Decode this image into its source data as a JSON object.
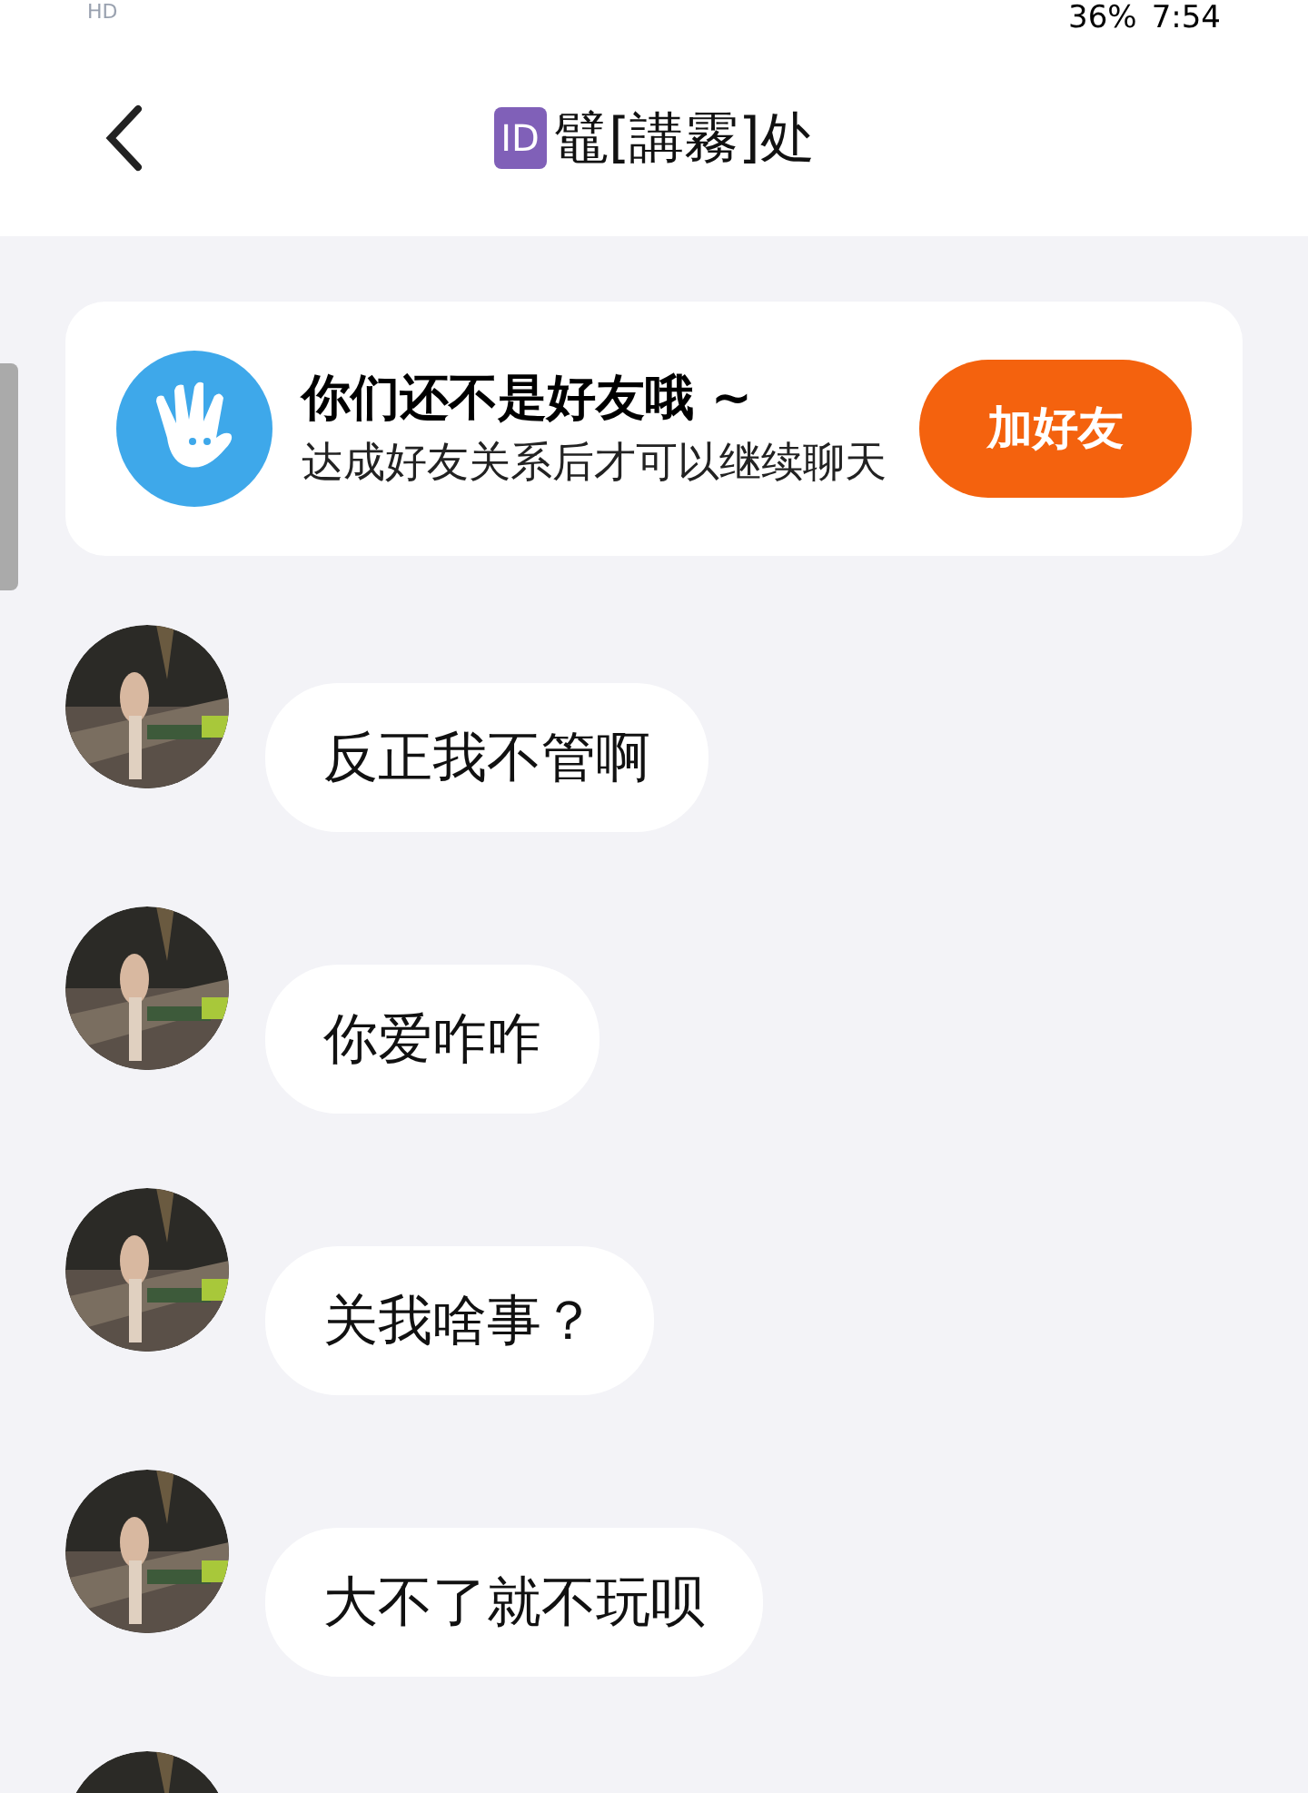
{
  "status_bar": {
    "network": "HD",
    "battery": "36%",
    "time": "7:54"
  },
  "header": {
    "badge": "ID",
    "title": "鼊[講霧]处"
  },
  "notice": {
    "title": "你们还不是好友哦 ~",
    "text": "达成好友关系后才可以继续聊天",
    "button": "加好友"
  },
  "messages": [
    {
      "text": "反正我不管啊"
    },
    {
      "text": "你爱咋咋"
    },
    {
      "text": "关我啥事？"
    },
    {
      "text": "大不了就不玩呗"
    }
  ]
}
